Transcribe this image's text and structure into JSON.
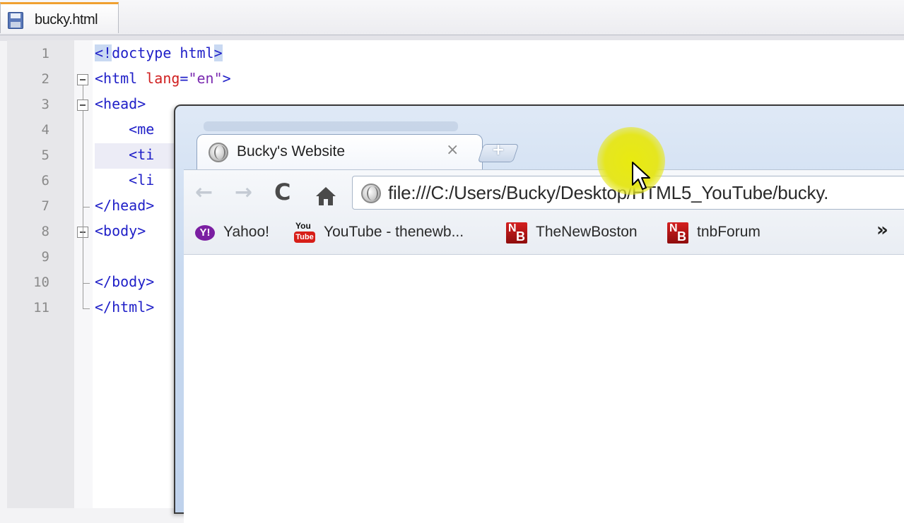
{
  "editor": {
    "tab_label": "bucky.html",
    "lines": [
      {
        "num": "1"
      },
      {
        "num": "2"
      },
      {
        "num": "3"
      },
      {
        "num": "4"
      },
      {
        "num": "5"
      },
      {
        "num": "6"
      },
      {
        "num": "7"
      },
      {
        "num": "8"
      },
      {
        "num": "9"
      },
      {
        "num": "10"
      },
      {
        "num": "11"
      }
    ],
    "code": {
      "l1_open": "<!",
      "l1_mid": "doctype html",
      "l1_close": ">",
      "l2_tag": "<html ",
      "l2_attr": "lang",
      "l2_eq": "=",
      "l2_str": "\"en\"",
      "l2_end": ">",
      "l3": "<head>",
      "l4": "    <me",
      "l5": "    <ti",
      "l6": "    <li",
      "l7": "</head>",
      "l8": "<body>",
      "l10": "</body>",
      "l11": "</html>"
    }
  },
  "browser": {
    "tab_title": "Bucky's Website",
    "tab_close": "×",
    "new_tab": "+",
    "back": "←",
    "forward": "→",
    "reload": "C",
    "url": "file:///C:/Users/Bucky/Desktop/HTML5_YouTube/bucky.",
    "bookmarks": {
      "yahoo": "Yahoo!",
      "youtube": "YouTube - thenewb...",
      "newboston": "TheNewBoston",
      "forum": "tnbForum"
    },
    "bookmark_icons": {
      "yahoo_glyph": "Y!",
      "yt_top": "You",
      "yt_bottom": "Tube",
      "nb_n": "N",
      "nb_b": "B"
    },
    "more_bookmarks": "»"
  }
}
